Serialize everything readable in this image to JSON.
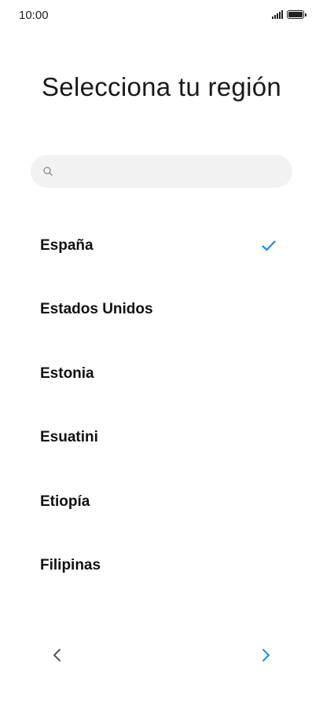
{
  "status_bar": {
    "time": "10:00",
    "signal_icon": "signal-icon",
    "battery_icon": "battery-icon",
    "battery_level": 1.0
  },
  "title": "Selecciona tu región",
  "search": {
    "placeholder": "",
    "value": "",
    "icon": "search-icon"
  },
  "regions": [
    {
      "label": "España",
      "selected": true
    },
    {
      "label": "Estados Unidos",
      "selected": false
    },
    {
      "label": "Estonia",
      "selected": false
    },
    {
      "label": "Esuatini",
      "selected": false
    },
    {
      "label": "Etiopía",
      "selected": false
    },
    {
      "label": "Filipinas",
      "selected": false
    }
  ],
  "navigation": {
    "back_icon": "chevron-left-icon",
    "next_icon": "chevron-right-icon"
  },
  "colors": {
    "accent": "#1a8cf0",
    "back_arrow": "#555555",
    "search_bg": "#f2f2f2"
  }
}
